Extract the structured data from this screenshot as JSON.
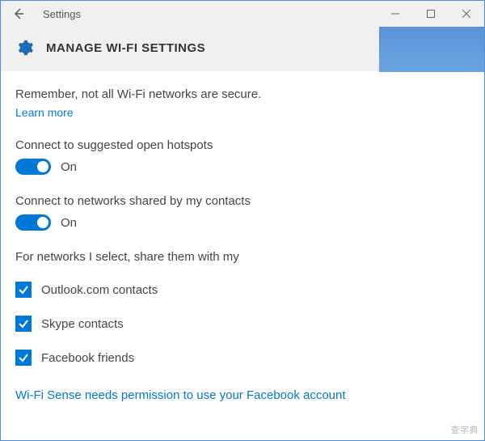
{
  "window": {
    "title": "Settings"
  },
  "page": {
    "title": "MANAGE WI-FI SETTINGS",
    "subtext": "Remember, not all Wi-Fi networks are secure.",
    "learn_more": "Learn more"
  },
  "toggles": [
    {
      "label": "Connect to suggested open hotspots",
      "state_text": "On"
    },
    {
      "label": "Connect to networks shared by my contacts",
      "state_text": "On"
    }
  ],
  "share_section": {
    "label": "For networks I select, share them with my",
    "items": [
      {
        "label": "Outlook.com contacts"
      },
      {
        "label": "Skype contacts"
      },
      {
        "label": "Facebook friends"
      }
    ]
  },
  "footer": {
    "link": "Wi-Fi Sense needs permission to use your Facebook account"
  },
  "watermark": "查字典"
}
